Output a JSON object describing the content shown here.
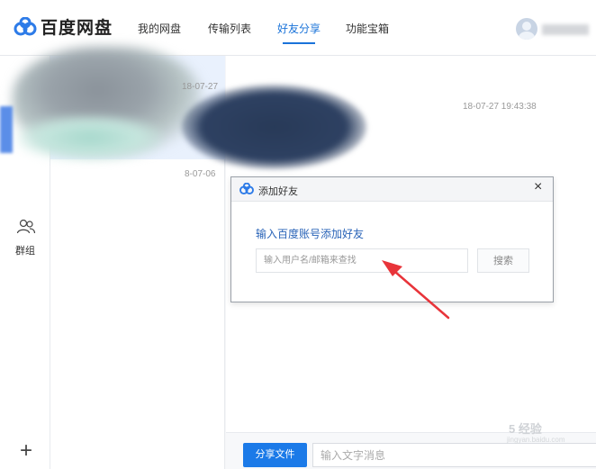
{
  "app": {
    "title": "百度网盘"
  },
  "nav": {
    "items": [
      {
        "label": "我的网盘"
      },
      {
        "label": "传输列表"
      },
      {
        "label": "好友分享",
        "active": true
      },
      {
        "label": "功能宝箱"
      }
    ]
  },
  "sidebar": {
    "group_label": "群组",
    "add_icon": "plus-icon"
  },
  "conversations": [
    {
      "date": "18-07-27"
    },
    {
      "date": "8-07-06"
    }
  ],
  "chat": {
    "timestamp": "18-07-27  19:43:38",
    "share_button": "分享文件",
    "message_placeholder": "输入文字消息"
  },
  "dialog": {
    "title": "添加好友",
    "close": "×",
    "heading": "输入百度账号添加好友",
    "input_placeholder": "输入用户名/邮箱来查找",
    "search_button": "搜索"
  },
  "plus_glyph": "+",
  "watermark": {
    "text": "5 经验",
    "sub": "jingyan.baidu.com"
  },
  "colors": {
    "accent": "#1b7ae8",
    "annotation_arrow": "#e8343a",
    "dialog_heading": "#2a64b8"
  }
}
